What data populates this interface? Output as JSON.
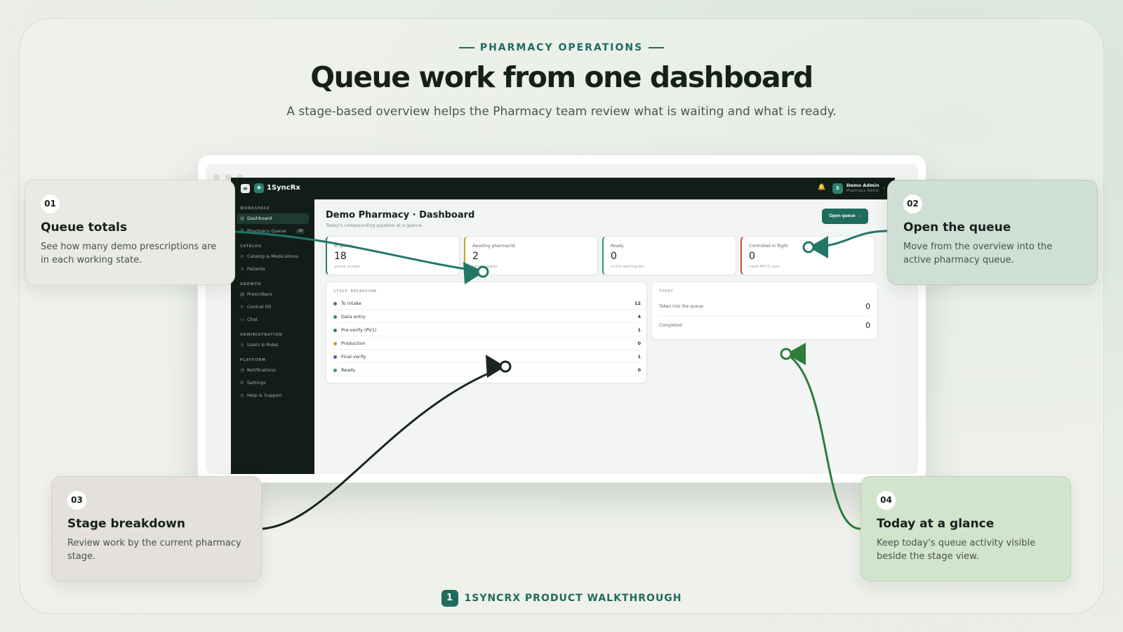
{
  "header": {
    "eyebrow": "PHARMACY OPERATIONS",
    "title": "Queue work from one dashboard",
    "subtitle": "A stage-based overview helps the Pharmacy team review what is waiting and what is ready."
  },
  "app": {
    "brand": "1SyncRx",
    "user": {
      "name": "Demo Admin",
      "role": "Pharmacy Admin",
      "initial": "S"
    },
    "sidebar": {
      "sections": [
        {
          "title": "WORKSPACE",
          "items": [
            {
              "label": "Dashboard",
              "icon": "grid-icon",
              "active": true
            },
            {
              "label": "Pharmacy Queue",
              "icon": "list-icon",
              "count": "18"
            }
          ]
        },
        {
          "title": "CATALOG",
          "items": [
            {
              "label": "Catalog & Medications",
              "icon": "pill-icon"
            },
            {
              "label": "Patients",
              "icon": "person-icon"
            }
          ]
        },
        {
          "title": "GROWTH",
          "items": [
            {
              "label": "Prescribers",
              "icon": "document-icon"
            },
            {
              "label": "Central Fill",
              "icon": "cross-icon"
            },
            {
              "label": "Chat",
              "icon": "chat-icon"
            }
          ]
        },
        {
          "title": "ADMINISTRATION",
          "items": [
            {
              "label": "Users & Roles",
              "icon": "users-icon"
            }
          ]
        },
        {
          "title": "PLATFORM",
          "items": [
            {
              "label": "Notifications",
              "icon": "bell-icon"
            },
            {
              "label": "Settings",
              "icon": "gear-icon"
            },
            {
              "label": "Help & Support",
              "icon": "help-icon"
            }
          ]
        }
      ]
    },
    "page": {
      "title": "Demo Pharmacy · Dashboard",
      "subtitle": "Today's compounding pipeline at a glance.",
      "open_button": "Open queue →"
    },
    "stats": [
      {
        "label": "In queue",
        "value": "18",
        "note": "active scripts",
        "accent": "#2a7f6c"
      },
      {
        "label": "Awaiting pharmacist",
        "value": "2",
        "note": "review gates",
        "accent": "#c9a227"
      },
      {
        "label": "Ready",
        "value": "0",
        "note": "in the waiting bin",
        "accent": "#3a9a63"
      },
      {
        "label": "Controlled in flight",
        "value": "0",
        "note": "need EPCS care",
        "accent": "#d0463b"
      }
    ],
    "stage_breakdown": {
      "title": "STAGE BREAKDOWN",
      "rows": [
        {
          "label": "To intake",
          "count": "12",
          "color": "#5f6a64"
        },
        {
          "label": "Data entry",
          "count": "4",
          "color": "#2a8a78"
        },
        {
          "label": "Pre-verify (PV1)",
          "count": "1",
          "color": "#2a7f6c"
        },
        {
          "label": "Production",
          "count": "0",
          "color": "#c79a2a"
        },
        {
          "label": "Final verify",
          "count": "1",
          "color": "#6b4fb8"
        },
        {
          "label": "Ready",
          "count": "0",
          "color": "#2f9a67"
        }
      ]
    },
    "today": {
      "title": "TODAY",
      "rows": [
        {
          "label": "Taken into the queue",
          "value": "0"
        },
        {
          "label": "Completed",
          "value": "0"
        }
      ]
    }
  },
  "callouts": [
    {
      "num": "01",
      "title": "Queue totals",
      "body": "See how many demo prescriptions are in each working state."
    },
    {
      "num": "02",
      "title": "Open the queue",
      "body": "Move from the overview into the active pharmacy queue."
    },
    {
      "num": "03",
      "title": "Stage breakdown",
      "body": "Review work by the current pharmacy stage."
    },
    {
      "num": "04",
      "title": "Today at a glance",
      "body": "Keep today's queue activity visible beside the stage view."
    }
  ],
  "footer": {
    "step": "1",
    "label": "1SYNCRX PRODUCT WALKTHROUGH"
  },
  "colors": {
    "brand": "#1f6b5e",
    "sidebar": "#121d18",
    "connector_teal": "#23776a",
    "connector_dark": "#1b2420",
    "connector_green": "#2e7d3a"
  }
}
